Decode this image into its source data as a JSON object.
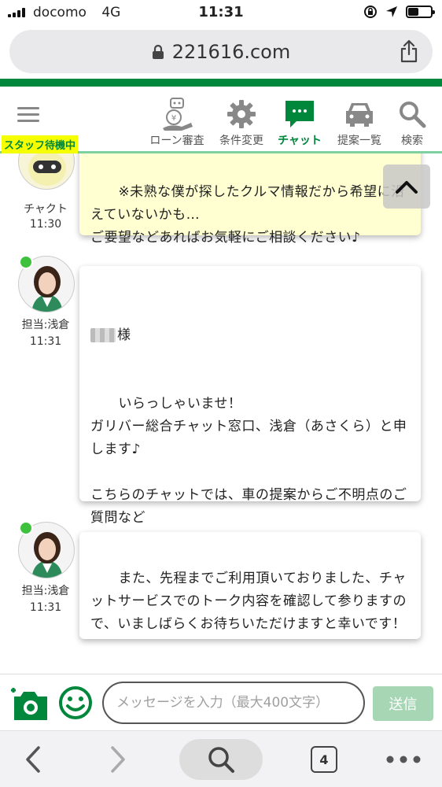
{
  "status_bar": {
    "carrier": "docomo",
    "network": "4G",
    "time": "11:31",
    "battery_level": 0.45
  },
  "browser": {
    "url": "221616.com",
    "tab_count": "4"
  },
  "colors": {
    "brand_green": "#00873c",
    "badge_yellow": "#f6ff00",
    "bubble_yellow": "#ffffd2",
    "online_green": "#3ec23e",
    "send_button_disabled": "#a7d6b5"
  },
  "header": {
    "staff_status": "スタッフ待機中",
    "nav": [
      {
        "label": "ローン審査",
        "icon": "loan-robot-icon"
      },
      {
        "label": "条件変更",
        "icon": "gear-icon"
      },
      {
        "label": "チャット",
        "icon": "chat-icon",
        "active": true
      },
      {
        "label": "提案一覧",
        "icon": "car-icon"
      },
      {
        "label": "検索",
        "icon": "search-icon"
      }
    ]
  },
  "messages": [
    {
      "sender": "チャクト",
      "time": "11:30",
      "avatar": "robot-avatar",
      "text": "※未熟な僕が探したクルマ情報だから希望に沿えていないかも…\nご要望などあればお気軽にご相談ください♪"
    },
    {
      "sender": "担当:浅倉",
      "time": "11:31",
      "avatar": "staff-avatar",
      "salutation": "様",
      "text": "いらっしゃいませ！\nガリバー総合チャット窓口、浅倉（あさくら）と申します♪\n\nこちらのチャットでは、車の提案からご不明点のご質問など\nクルマに関することをなんでもご案内させていただけます！"
    },
    {
      "sender": "担当:浅倉",
      "time": "11:31",
      "avatar": "staff-avatar",
      "text": "また、先程までご利用頂いておりました、チャットサービスでのトーク内容を確認して参りますので、いましばらくお待ちいただけますと幸いです！"
    }
  ],
  "composer": {
    "placeholder": "メッセージを入力（最大400文字）",
    "send_label": "送信"
  }
}
